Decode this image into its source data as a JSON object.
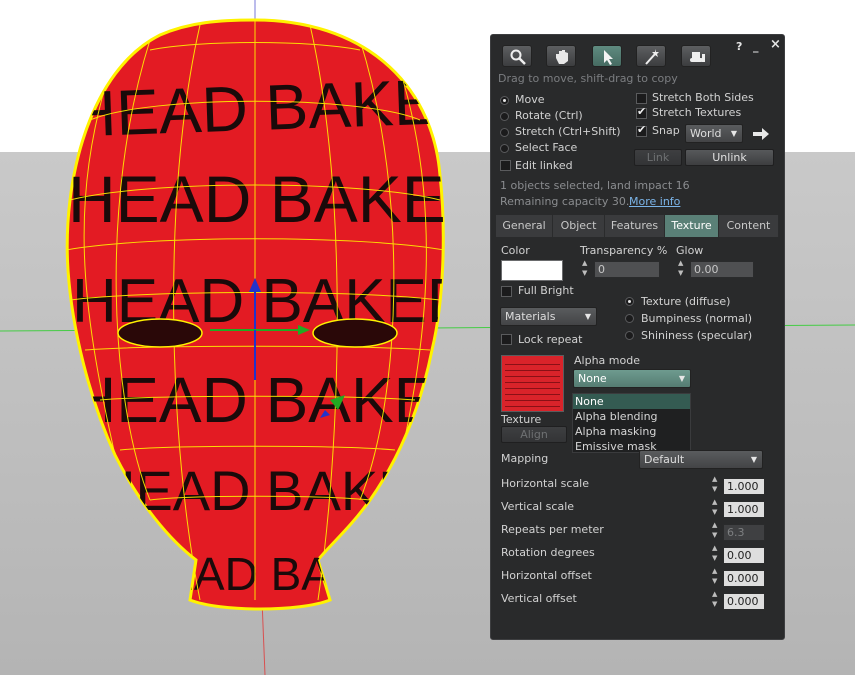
{
  "scene": {
    "head_text": "HEAD BAKED",
    "colors": {
      "head": "#e31b23",
      "wireframe": "#fff200",
      "ground": "#c2c2c2",
      "sky": "#ffffff"
    }
  },
  "panel": {
    "header_icons": [
      "focus-icon",
      "grab-hand-icon",
      "edit-arrow-icon",
      "magic-wand-create-icon",
      "bulldozer-land-icon"
    ],
    "help": "?",
    "minimize": "_",
    "close": "×",
    "hint": "Drag to move, shift-drag to copy",
    "modes": [
      "Move",
      "Rotate (Ctrl)",
      "Stretch (Ctrl+Shift)",
      "Select Face"
    ],
    "edit_linked": "Edit linked",
    "stretch_both_sides": "Stretch Both Sides",
    "stretch_textures": "Stretch Textures",
    "snap": "Snap",
    "snap_mode": "World",
    "link_btn": "Link",
    "unlink_btn": "Unlink",
    "status_line1": "1 objects selected, land impact 16",
    "status_line2": "Remaining capacity 30.",
    "more_info": "More info",
    "tabs": [
      "General",
      "Object",
      "Features",
      "Texture",
      "Content"
    ],
    "active_tab": "Texture",
    "texture": {
      "color_label": "Color",
      "transparency_label": "Transparency %",
      "transparency_value": "0",
      "glow_label": "Glow",
      "glow_value": "0.00",
      "full_bright": "Full Bright",
      "materials_combo": "Materials",
      "lock_repeat": "Lock repeat",
      "map_options": [
        "Texture (diffuse)",
        "Bumpiness (normal)",
        "Shininess (specular)"
      ],
      "texture_label": "Texture",
      "align_btn": "Align",
      "alpha_mode_label": "Alpha mode",
      "alpha_mode_value": "None",
      "alpha_options": [
        "None",
        "Alpha blending",
        "Alpha masking",
        "Emissive mask"
      ],
      "mapping_label": "Mapping",
      "mapping_value": "Default",
      "params": [
        {
          "label": "Horizontal scale",
          "value": "1.000"
        },
        {
          "label": "Vertical scale",
          "value": "1.000"
        },
        {
          "label": "Repeats per meter",
          "value": "6.3"
        },
        {
          "label": "Rotation degrees",
          "value": "0.00"
        },
        {
          "label": "Horizontal offset",
          "value": "0.000"
        },
        {
          "label": "Vertical offset",
          "value": "0.000"
        }
      ]
    }
  }
}
